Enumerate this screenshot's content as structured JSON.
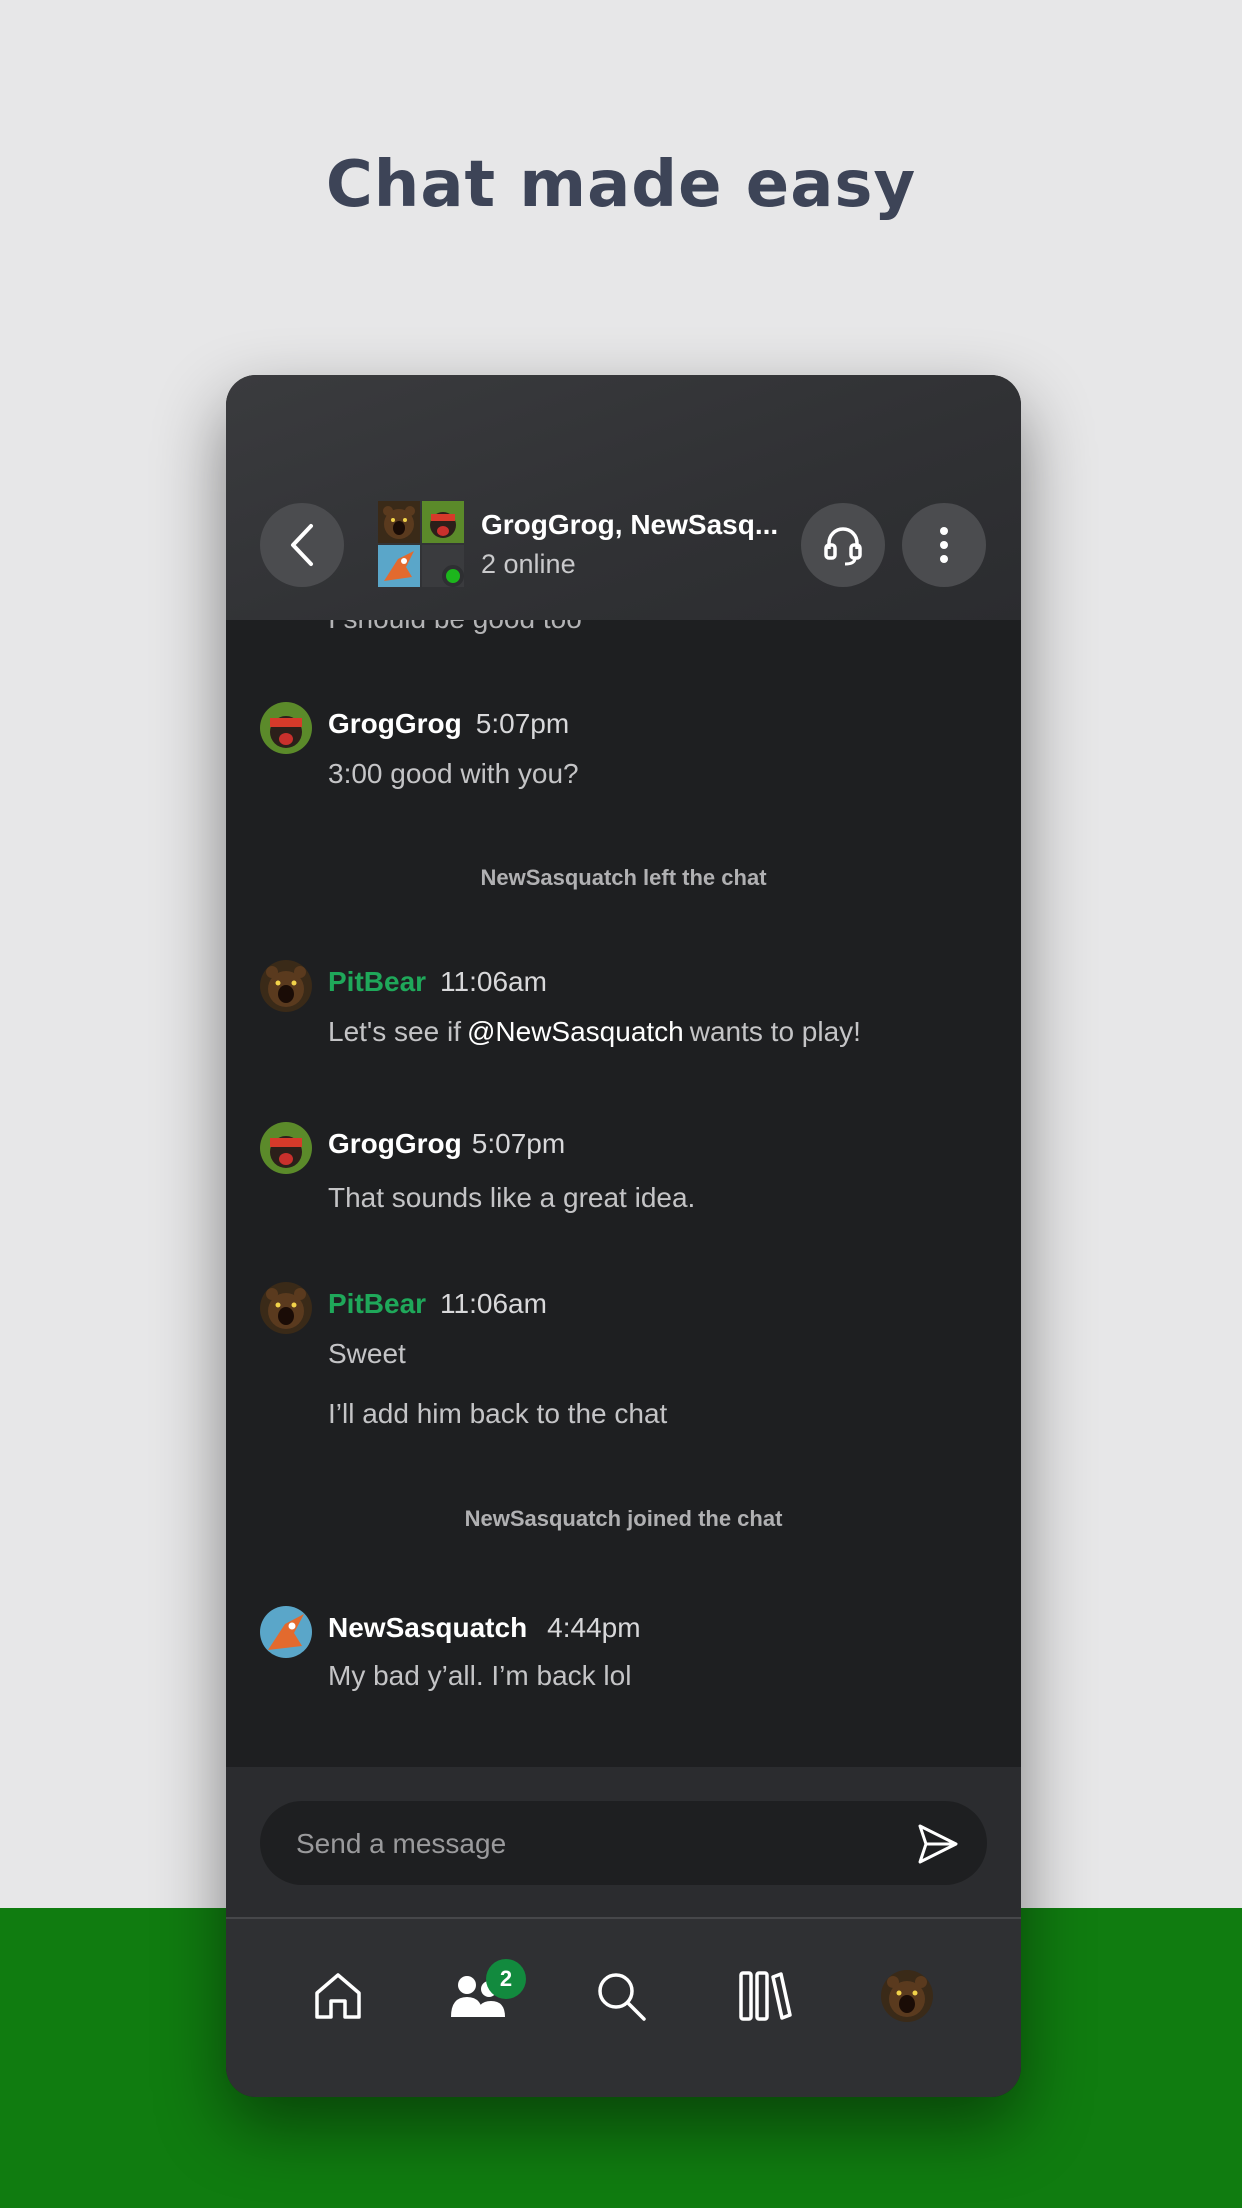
{
  "headline": "Chat made easy",
  "header": {
    "title": "GrogGrog, NewSasq...",
    "subtitle": "2 online"
  },
  "messages": {
    "cutoff_text": "I should be good too",
    "m1": {
      "name": "GrogGrog",
      "time": "5:07pm",
      "text": "3:00 good with you?"
    },
    "sys1": "NewSasquatch left the chat",
    "m2": {
      "name": "PitBear",
      "time": "11:06am",
      "text_before": "Let's see if",
      "mention": "@NewSasquatch",
      "text_after": "wants to play!"
    },
    "m3": {
      "name": "GrogGrog",
      "time": "5:07pm",
      "text": "That sounds like a great idea."
    },
    "m4": {
      "name": "PitBear",
      "time": "11:06am",
      "text1": "Sweet",
      "text2": "I’ll add him back to the chat"
    },
    "sys2": "NewSasquatch joined the chat",
    "m5": {
      "name": "NewSasquatch",
      "time": "4:44pm",
      "text": "My bad y’all. I’m back lol"
    }
  },
  "composer": {
    "placeholder": "Send a message"
  },
  "nav": {
    "items": [
      "home-icon",
      "friends-icon",
      "search-icon",
      "library-icon",
      "profile-avatar"
    ],
    "friends_badge": "2"
  },
  "colors": {
    "accent_green": "#107c10",
    "name_green": "#1fa85a",
    "badge_green": "#128a3e",
    "chat_bg": "#1e1f21"
  }
}
